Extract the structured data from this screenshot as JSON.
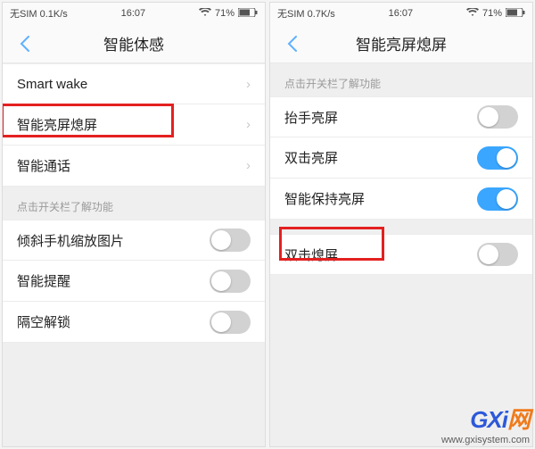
{
  "left_phone": {
    "status": {
      "sim": "无SIM 0.1K/s",
      "time": "16:07",
      "battery": "71%"
    },
    "title": "智能体感",
    "rows_nav": [
      {
        "label": "Smart wake"
      },
      {
        "label": "智能亮屏熄屏"
      },
      {
        "label": "智能通话"
      }
    ],
    "hint": "点击开关栏了解功能",
    "rows_toggle": [
      {
        "label": "倾斜手机缩放图片",
        "on": false
      },
      {
        "label": "智能提醒",
        "on": false
      },
      {
        "label": "隔空解锁",
        "on": false
      }
    ]
  },
  "right_phone": {
    "status": {
      "sim": "无SIM 0.7K/s",
      "time": "16:07",
      "battery": "71%"
    },
    "title": "智能亮屏熄屏",
    "hint": "点击开关栏了解功能",
    "rows_toggle": [
      {
        "label": "抬手亮屏",
        "on": false
      },
      {
        "label": "双击亮屏",
        "on": true
      },
      {
        "label": "智能保持亮屏",
        "on": true
      },
      {
        "label": "双击熄屏",
        "on": false
      }
    ]
  },
  "watermark": {
    "logo_main": "GXi",
    "logo_suffix": "网",
    "url": "www.gxisystem.com"
  }
}
